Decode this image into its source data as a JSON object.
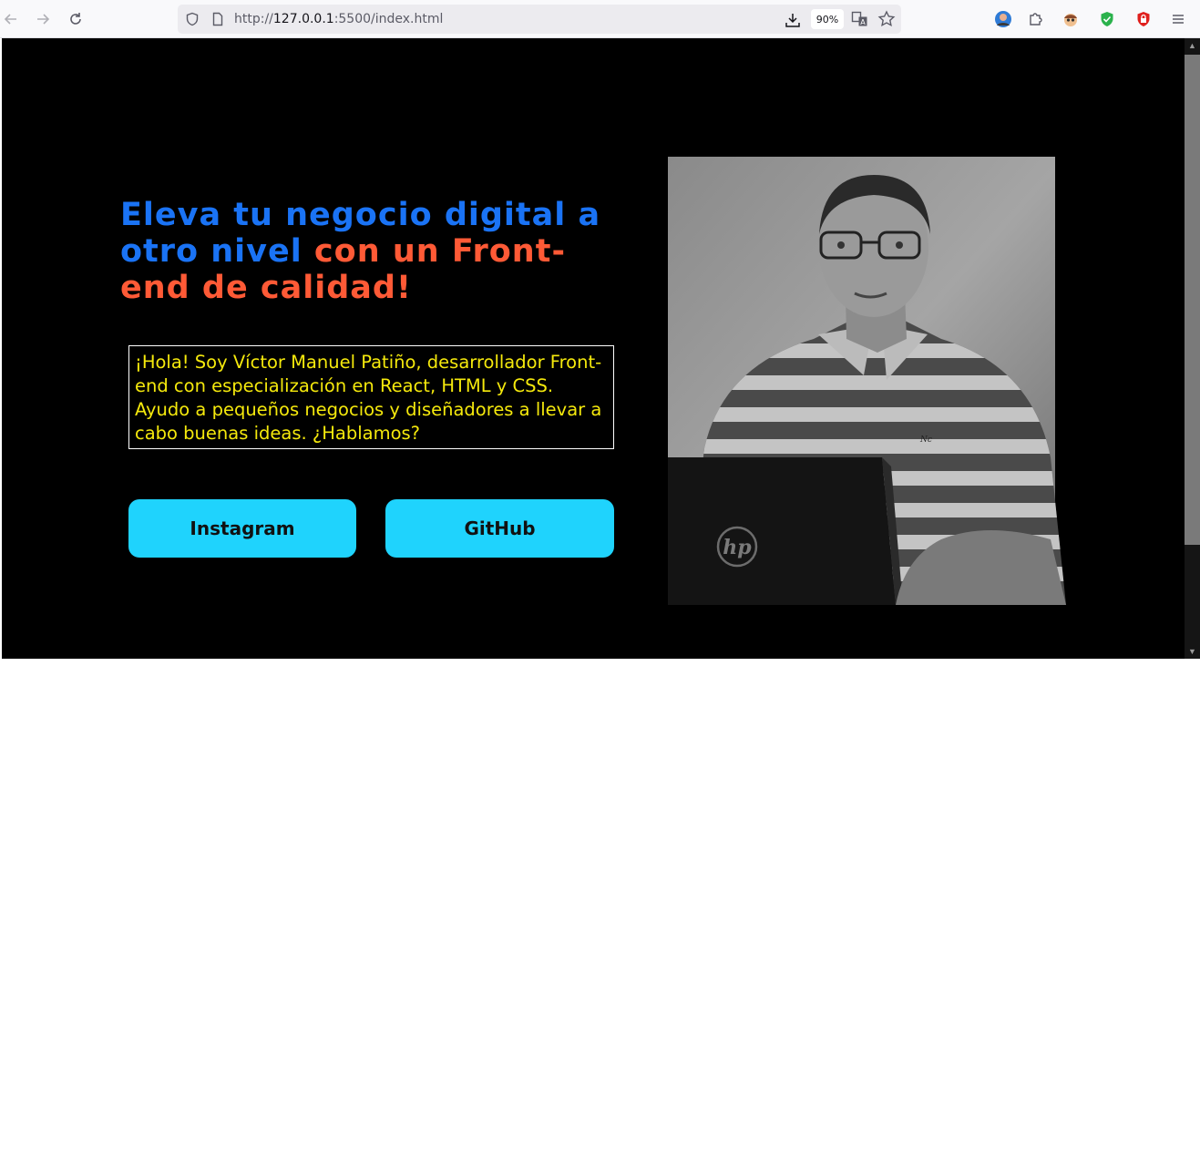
{
  "browser": {
    "url_scheme": "http://",
    "url_host": "127.0.0.1",
    "url_rest": ":5500/index.html",
    "zoom": "90%",
    "icons": {
      "back": "arrow-left-icon",
      "forward": "arrow-right-icon",
      "reload": "reload-icon",
      "shield": "tracking-shield-icon",
      "page": "page-info-icon",
      "download": "download-icon",
      "translate": "translate-icon",
      "bookmark": "star-icon",
      "account": "account-avatar-icon",
      "extensions": "puzzle-icon",
      "extension_face": "extension-face-icon",
      "extension_shield": "green-shield-icon",
      "extension_lock": "red-lock-icon",
      "menu": "hamburger-menu-icon"
    }
  },
  "hero": {
    "headline_blue": "Eleva tu negocio digital a otro nivel ",
    "headline_orange": "con un Front-end de calidad!",
    "intro": "¡Hola! Soy Víctor Manuel Patiño, desarrollador Front-end con especialización en React, HTML y CSS. Ayudo a pequeños negocios y diseñadores a llevar a cabo buenas ideas. ¿Hablamos?",
    "buttons": {
      "instagram": "Instagram",
      "github": "GitHub"
    },
    "laptop_logo": "hp",
    "shirt_logo": "Nc"
  },
  "colors": {
    "page_bg": "#000000",
    "headline_blue": "#1a73f5",
    "headline_orange": "#ff5a36",
    "intro_text": "#f5e90c",
    "button_bg": "#1fd3fd"
  }
}
